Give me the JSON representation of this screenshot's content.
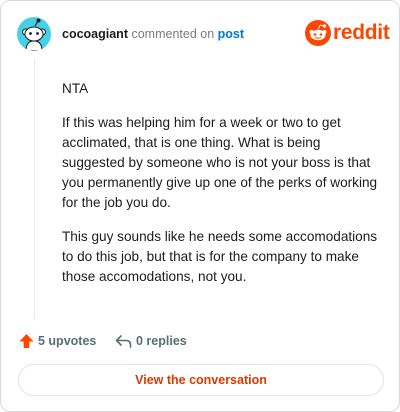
{
  "header": {
    "username": "cocoagiant",
    "action_text": "commented on",
    "post_link": "post",
    "brand": "reddit"
  },
  "comment": {
    "paragraphs": [
      "NTA",
      "If this was helping him for a week or two to get acclimated, that is one thing. What is being suggested by someone who is not your boss is that you permanently give up one of the perks of working for the job you do.",
      "This guy sounds like he needs some accomodations to do this job, but that is for the company to make those accomodations, not you."
    ]
  },
  "actions": {
    "upvotes": "5 upvotes",
    "replies": "0 replies"
  },
  "cta": {
    "label": "View the conversation"
  },
  "colors": {
    "brand": "#ff4500",
    "link": "#0079d3",
    "cta_text": "#d93a00",
    "avatar_bg": "#46d0e6"
  },
  "icons": [
    "snoo-avatar-icon",
    "reddit-logo-icon",
    "upvote-arrow-icon",
    "reply-arrow-icon"
  ]
}
